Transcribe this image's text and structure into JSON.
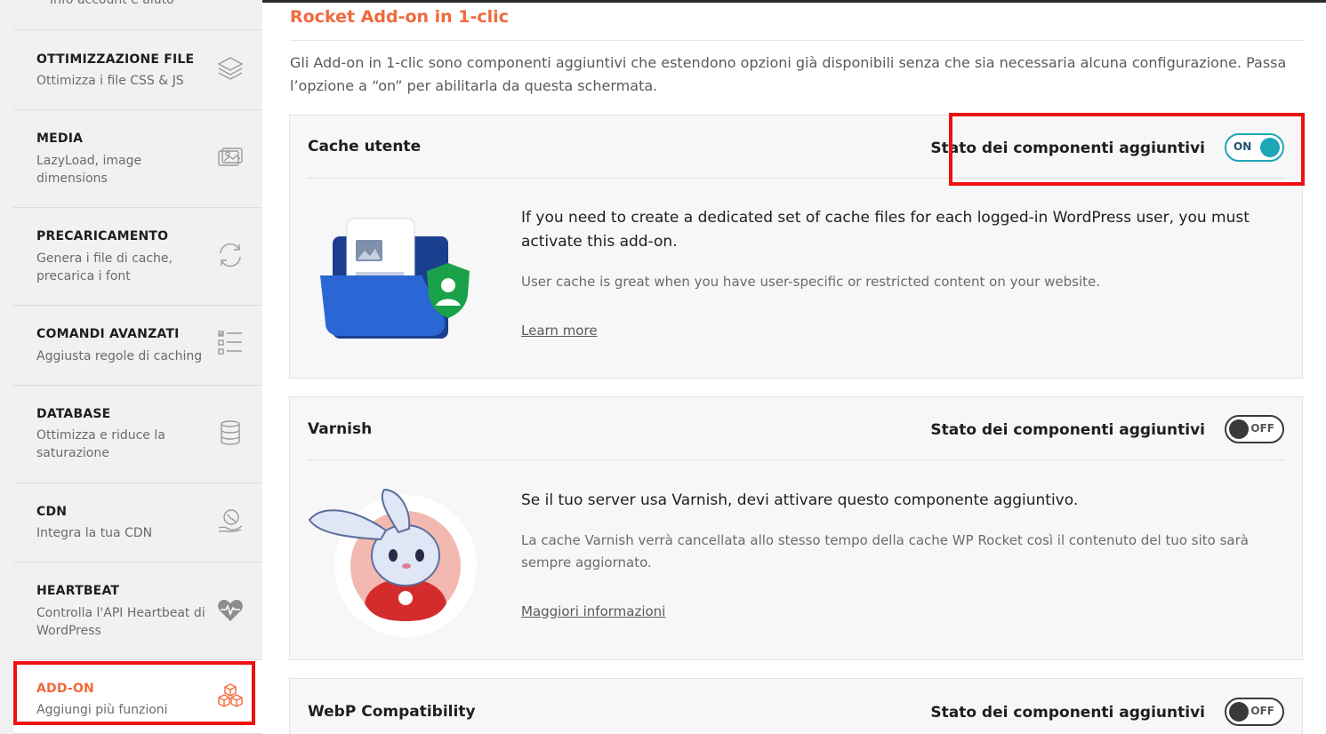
{
  "sidebar": {
    "partial_top_label": "Info account e aiuto",
    "items": [
      {
        "title": "OTTIMIZZAZIONE FILE",
        "desc": "Ottimizza i file CSS & JS",
        "icon": "layers-icon"
      },
      {
        "title": "MEDIA",
        "desc": "LazyLoad, image dimensions",
        "icon": "images-icon"
      },
      {
        "title": "PRECARICAMENTO",
        "desc": "Genera i file di cache, precarica i font",
        "icon": "refresh-icon"
      },
      {
        "title": "COMANDI AVANZATI",
        "desc": "Aggiusta regole di caching",
        "icon": "checklist-icon"
      },
      {
        "title": "DATABASE",
        "desc": "Ottimizza e riduce la saturazione",
        "icon": "database-icon"
      },
      {
        "title": "CDN",
        "desc": "Integra la tua CDN",
        "icon": "globe-hand-icon"
      },
      {
        "title": "HEARTBEAT",
        "desc": "Controlla l'API Heartbeat di WordPress",
        "icon": "heartbeat-icon"
      },
      {
        "title": "ADD-ON",
        "desc": "Aggiungi più funzioni",
        "icon": "boxes-icon",
        "active": true
      }
    ]
  },
  "main": {
    "title": "Rocket Add-on in 1-clic",
    "intro": "Gli Add-on in 1-clic sono componenti aggiuntivi che estendono opzioni già disponibili senza che sia necessaria alcuna configurazione. Passa l’opzione a “on” per abilitarla da questa schermata.",
    "cards": [
      {
        "name": "Cache utente",
        "status_label": "Stato dei componenti aggiuntivi",
        "toggle": "ON",
        "lead": "If you need to create a dedicated set of cache files for each logged-in WordPress user, you must activate this add-on.",
        "sub": "User cache is great when you have user-specific or restricted content on your website.",
        "link": "Learn more"
      },
      {
        "name": "Varnish",
        "status_label": "Stato dei componenti aggiuntivi",
        "toggle": "OFF",
        "lead": "Se il tuo server usa Varnish, devi attivare questo componente aggiuntivo.",
        "sub": "La cache Varnish verrà cancellata allo stesso tempo della cache WP Rocket così il contenuto del tuo sito sarà sempre aggiornato.",
        "link": "Maggiori informazioni"
      },
      {
        "name": "WebP Compatibility",
        "status_label": "Stato dei componenti aggiuntivi",
        "toggle": "OFF"
      }
    ]
  },
  "colors": {
    "accent": "#f06a3b",
    "toggle_on": "#1ba7b6",
    "highlight_box": "#ee1111"
  }
}
